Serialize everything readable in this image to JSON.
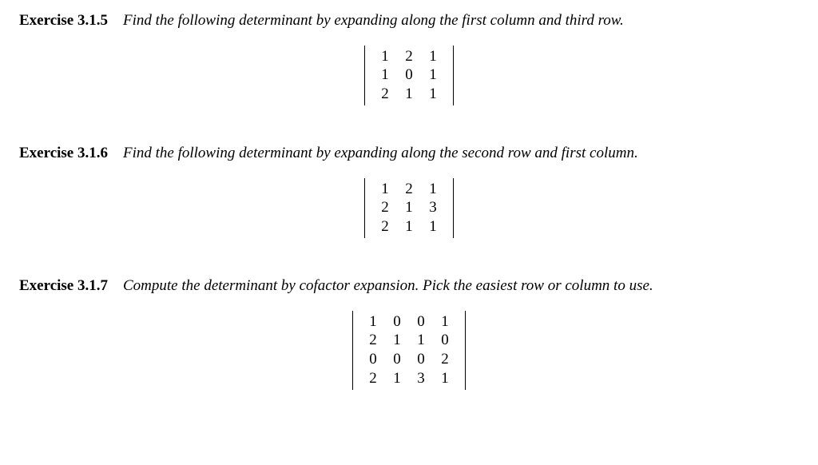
{
  "exercises": [
    {
      "label": "Exercise 3.1.5",
      "prompt": "Find the following determinant by expanding along the first column and third row.",
      "matrix": [
        [
          "1",
          "2",
          "1"
        ],
        [
          "1",
          "0",
          "1"
        ],
        [
          "2",
          "1",
          "1"
        ]
      ]
    },
    {
      "label": "Exercise 3.1.6",
      "prompt": "Find the following determinant by expanding along the second row and first column.",
      "matrix": [
        [
          "1",
          "2",
          "1"
        ],
        [
          "2",
          "1",
          "3"
        ],
        [
          "2",
          "1",
          "1"
        ]
      ]
    },
    {
      "label": "Exercise 3.1.7",
      "prompt": "Compute the determinant by cofactor expansion. Pick the easiest row or column to use.",
      "matrix": [
        [
          "1",
          "0",
          "0",
          "1"
        ],
        [
          "2",
          "1",
          "1",
          "0"
        ],
        [
          "0",
          "0",
          "0",
          "2"
        ],
        [
          "2",
          "1",
          "3",
          "1"
        ]
      ]
    }
  ]
}
